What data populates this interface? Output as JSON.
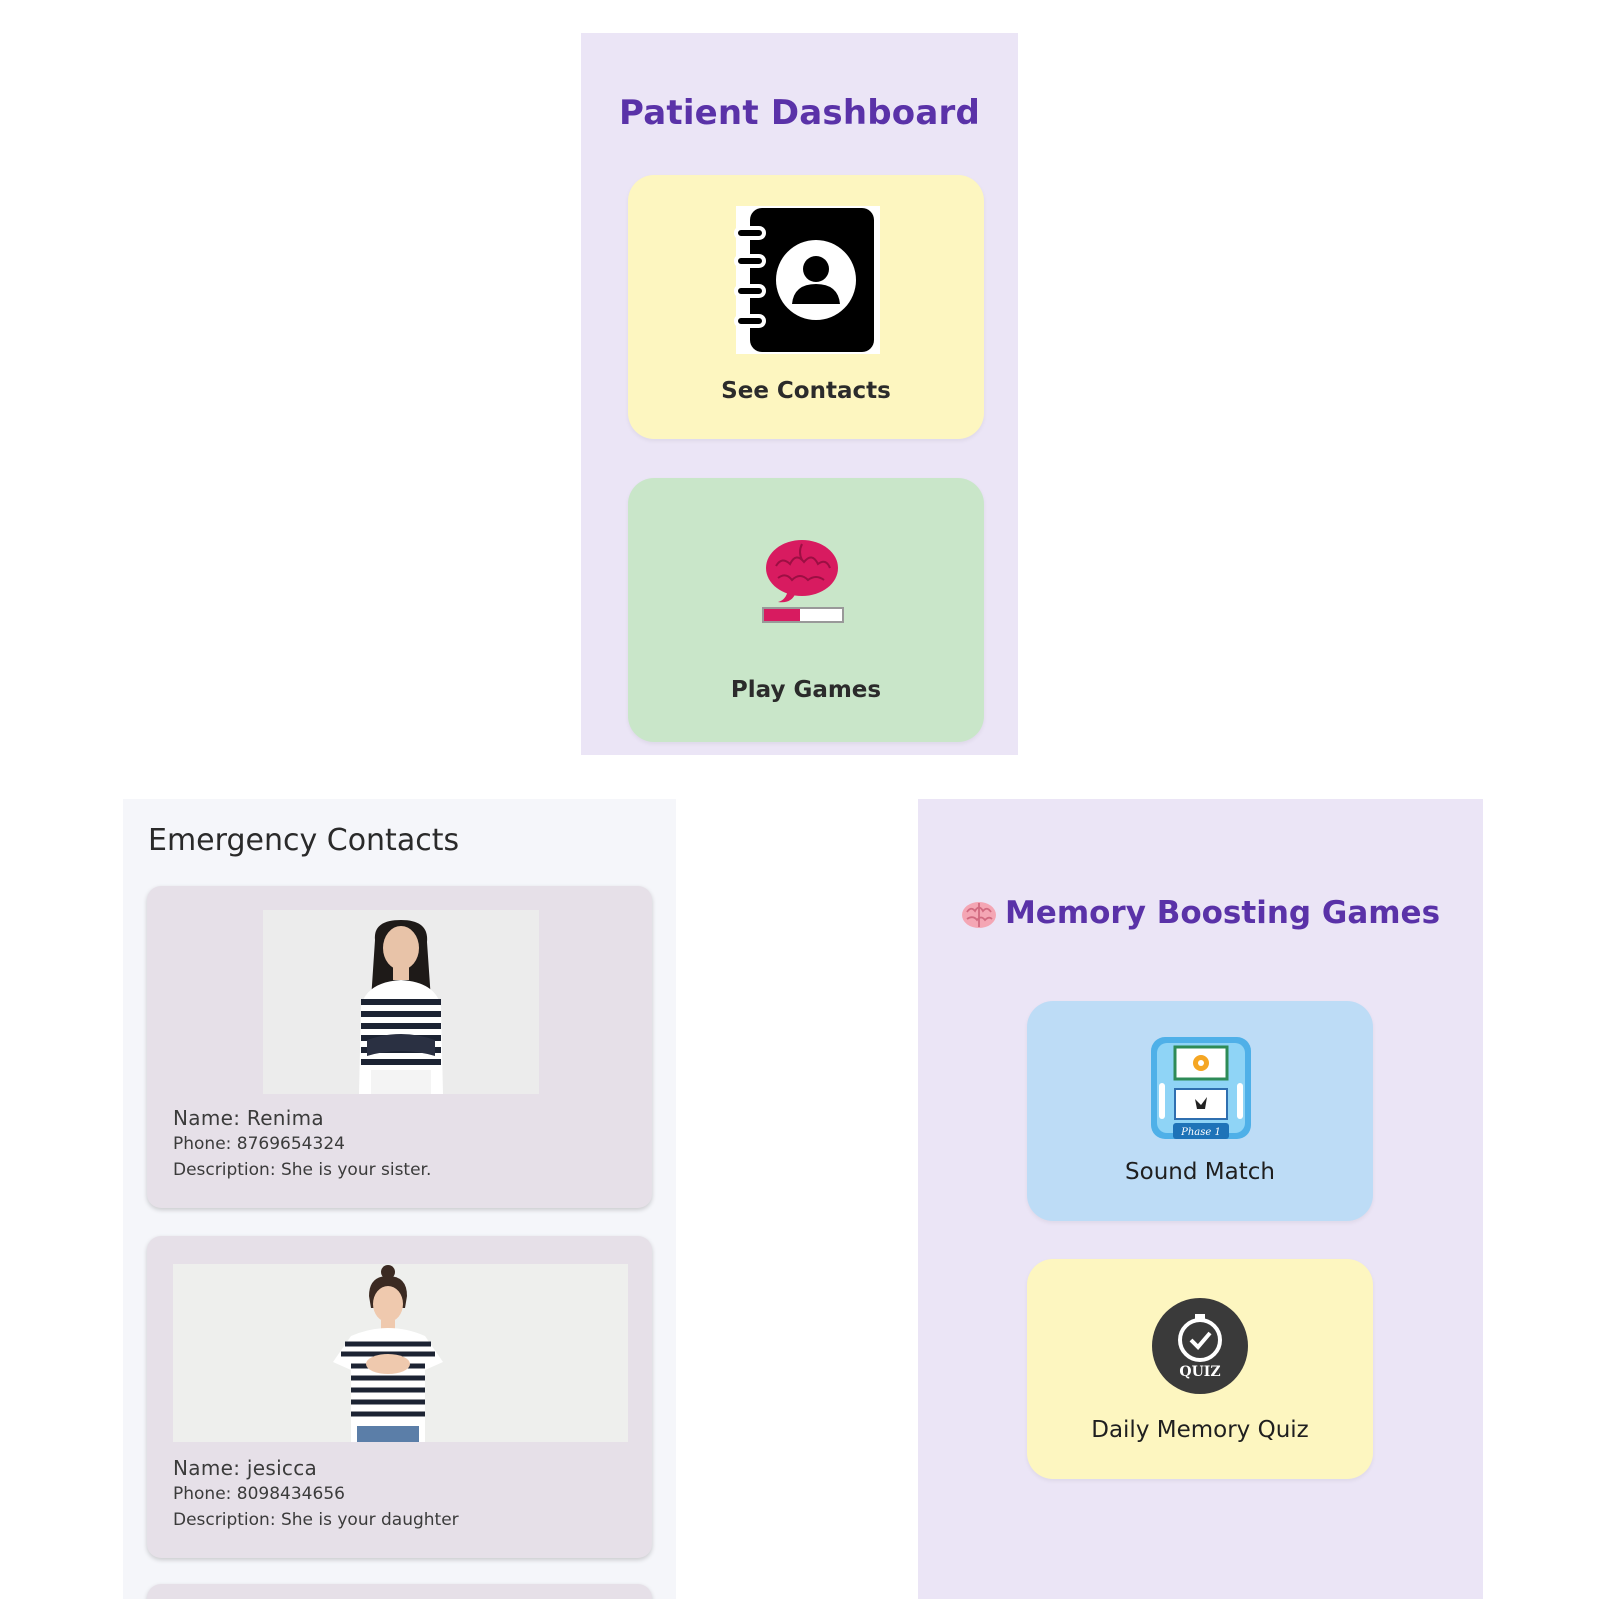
{
  "dashboard": {
    "title": "Patient Dashboard",
    "tiles": [
      {
        "label": "See Contacts",
        "icon": "contact-book-icon",
        "color": "#fdf6c0"
      },
      {
        "label": "Play Games",
        "icon": "brain-progress-icon",
        "color": "#c9e6c9"
      }
    ],
    "accent": "#5a32a8"
  },
  "contacts": {
    "title": "Emergency Contacts",
    "items": [
      {
        "name": "Name: Renima",
        "phone": "Phone: 8769654324",
        "description": "Description: She is your sister."
      },
      {
        "name": "Name: jesicca",
        "phone": "Phone: 8098434656",
        "description": "Description: She is your daughter"
      }
    ]
  },
  "games": {
    "title": "Memory Boosting Games",
    "items": [
      {
        "label": "Sound Match",
        "icon": "sound-match-icon",
        "icon_caption": "Phase 1",
        "color": "#bddcf6"
      },
      {
        "label": "Daily Memory Quiz",
        "icon": "quiz-stopwatch-icon",
        "icon_caption": "QUIZ",
        "color": "#fdf6c0"
      }
    ]
  }
}
